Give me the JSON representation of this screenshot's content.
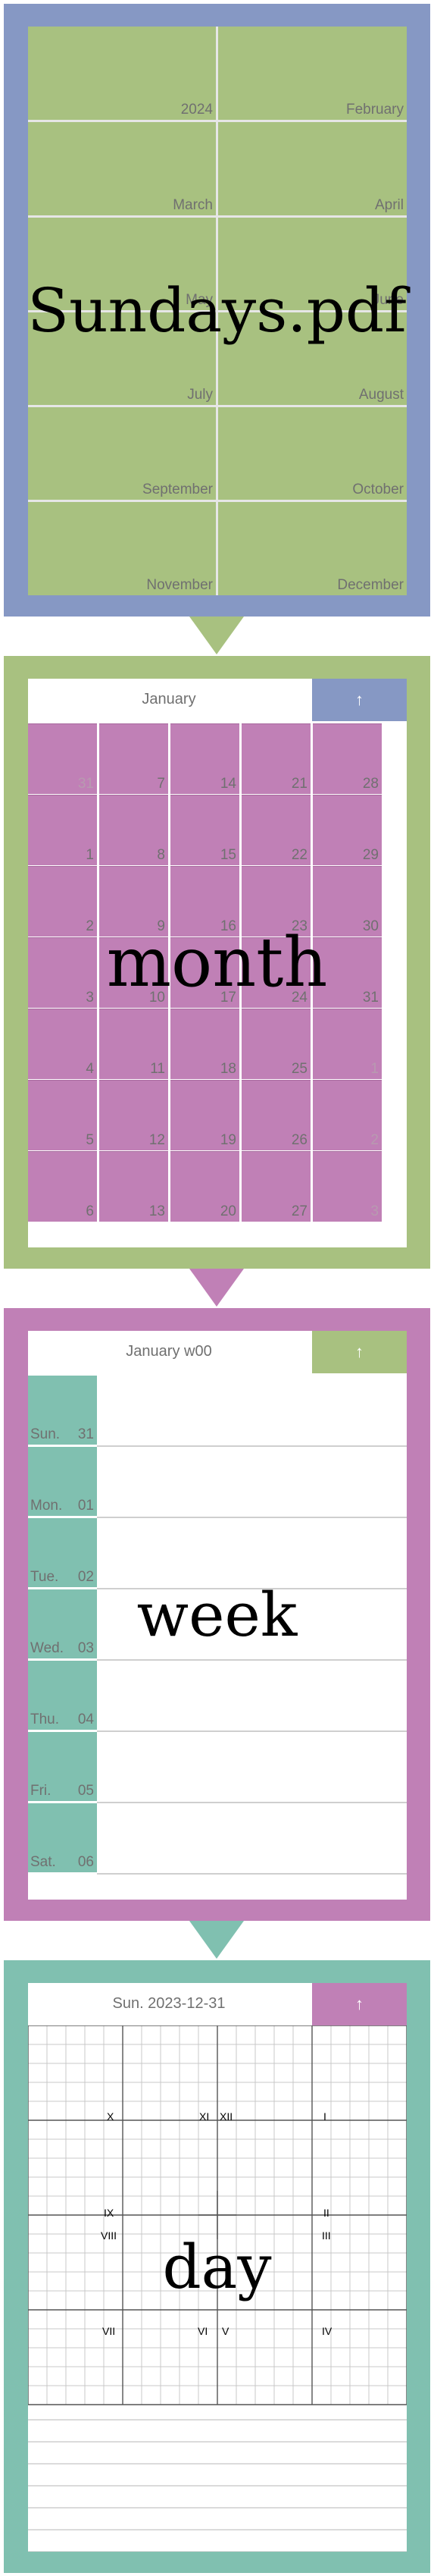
{
  "colors": {
    "blue_frame": "#8698c4",
    "green_frame": "#a8c180",
    "pink_frame": "#c080b6",
    "teal_frame": "#80c0b0",
    "year_cell": "#a8c180",
    "month_cell": "#c080b6",
    "week_day_cell": "#80c0b0",
    "grid_line": "#e6e6e6"
  },
  "year_page": {
    "watermark": "Sundays.pdf",
    "cells": [
      "2024",
      "February",
      "March",
      "April",
      "May",
      "June",
      "July",
      "August",
      "September",
      "October",
      "November",
      "December"
    ]
  },
  "month_page": {
    "watermark": "month",
    "title": "January",
    "up_label": "↑",
    "rows": [
      [
        "31",
        "7",
        "14",
        "21",
        "28"
      ],
      [
        "1",
        "8",
        "15",
        "22",
        "29"
      ],
      [
        "2",
        "9",
        "16",
        "23",
        "30"
      ],
      [
        "3",
        "10",
        "17",
        "24",
        "31"
      ],
      [
        "4",
        "11",
        "18",
        "25",
        "1"
      ],
      [
        "5",
        "12",
        "19",
        "26",
        "2"
      ],
      [
        "6",
        "13",
        "20",
        "27",
        "3"
      ]
    ]
  },
  "week_page": {
    "watermark": "week",
    "title": "January w00",
    "up_label": "↑",
    "days": [
      {
        "name": "Sun.",
        "num": "31"
      },
      {
        "name": "Mon.",
        "num": "01"
      },
      {
        "name": "Tue.",
        "num": "02"
      },
      {
        "name": "Wed.",
        "num": "03"
      },
      {
        "name": "Thu.",
        "num": "04"
      },
      {
        "name": "Fri.",
        "num": "05"
      },
      {
        "name": "Sat.",
        "num": "06"
      }
    ]
  },
  "day_page": {
    "watermark": "day",
    "title": "Sun. 2023-12-31",
    "up_label": "↑",
    "hours": {
      "h10": "X",
      "h11": "XI",
      "h12": "XII",
      "h1": "I",
      "h9": "IX",
      "h2": "II",
      "h8": "VIII",
      "h3": "III",
      "h7": "VII",
      "h6": "VI",
      "h5": "V",
      "h4": "IV"
    }
  }
}
